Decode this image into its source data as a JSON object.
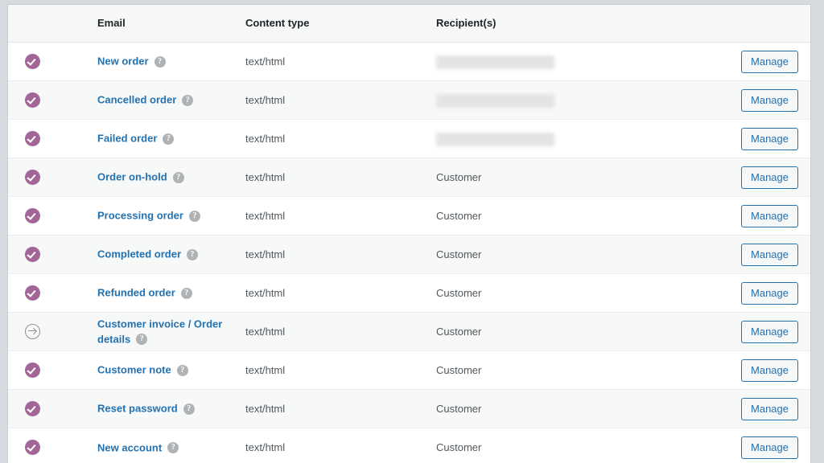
{
  "table": {
    "columns": [
      {
        "key": "status",
        "label": ""
      },
      {
        "key": "email",
        "label": "Email"
      },
      {
        "key": "type",
        "label": "Content type"
      },
      {
        "key": "recip",
        "label": "Recipient(s)"
      },
      {
        "key": "actions",
        "label": ""
      }
    ],
    "rows": [
      {
        "status": "enabled",
        "status_icon": "check-circle-icon",
        "email": "New order",
        "help": "?",
        "type": "text/html",
        "recipient": "",
        "recipient_redacted": true,
        "action": "Manage"
      },
      {
        "status": "enabled",
        "status_icon": "check-circle-icon",
        "email": "Cancelled order",
        "help": "?",
        "type": "text/html",
        "recipient": "",
        "recipient_redacted": true,
        "action": "Manage"
      },
      {
        "status": "enabled",
        "status_icon": "check-circle-icon",
        "email": "Failed order",
        "help": "?",
        "type": "text/html",
        "recipient": "",
        "recipient_redacted": true,
        "action": "Manage"
      },
      {
        "status": "enabled",
        "status_icon": "check-circle-icon",
        "email": "Order on-hold",
        "help": "?",
        "type": "text/html",
        "recipient": "Customer",
        "recipient_redacted": false,
        "action": "Manage"
      },
      {
        "status": "enabled",
        "status_icon": "check-circle-icon",
        "email": "Processing order",
        "help": "?",
        "type": "text/html",
        "recipient": "Customer",
        "recipient_redacted": false,
        "action": "Manage"
      },
      {
        "status": "enabled",
        "status_icon": "check-circle-icon",
        "email": "Completed order",
        "help": "?",
        "type": "text/html",
        "recipient": "Customer",
        "recipient_redacted": false,
        "action": "Manage"
      },
      {
        "status": "enabled",
        "status_icon": "check-circle-icon",
        "email": "Refunded order",
        "help": "?",
        "type": "text/html",
        "recipient": "Customer",
        "recipient_redacted": false,
        "action": "Manage"
      },
      {
        "status": "disabled",
        "status_icon": "arrow-circle-right-icon",
        "email": "Customer invoice / Order details",
        "help": "?",
        "type": "text/html",
        "recipient": "Customer",
        "recipient_redacted": false,
        "action": "Manage"
      },
      {
        "status": "enabled",
        "status_icon": "check-circle-icon",
        "email": "Customer note",
        "help": "?",
        "type": "text/html",
        "recipient": "Customer",
        "recipient_redacted": false,
        "action": "Manage"
      },
      {
        "status": "enabled",
        "status_icon": "check-circle-icon",
        "email": "Reset password",
        "help": "?",
        "type": "text/html",
        "recipient": "Customer",
        "recipient_redacted": false,
        "action": "Manage"
      },
      {
        "status": "enabled",
        "status_icon": "check-circle-icon",
        "email": "New account",
        "help": "?",
        "type": "text/html",
        "recipient": "Customer",
        "recipient_redacted": false,
        "action": "Manage"
      }
    ]
  },
  "colors": {
    "enabled_status": "#a46497",
    "disabled_status": "#8d9196",
    "link": "#2271b1",
    "button_border": "#2271b1",
    "page_background": "#d6d9dd",
    "row_alt_background": "#f7f8f8",
    "header_background": "#f6f7f7"
  }
}
